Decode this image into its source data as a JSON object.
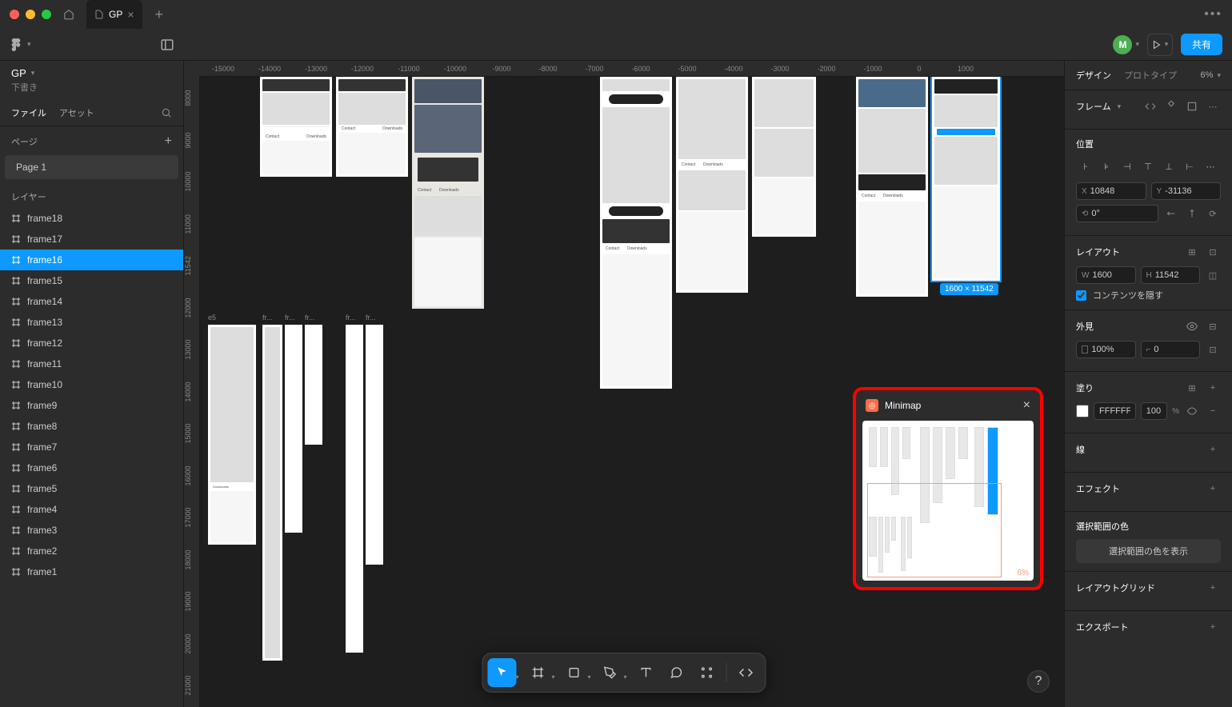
{
  "titlebar": {
    "tab_name": "GP",
    "menu_dots": "•••"
  },
  "left_panel": {
    "file_name": "GP",
    "file_status": "下書き",
    "lib_tabs": {
      "file": "ファイル",
      "assets": "アセット"
    },
    "pages_label": "ページ",
    "pages": [
      "Page 1"
    ],
    "layers_label": "レイヤー",
    "layers": [
      "frame18",
      "frame17",
      "frame16",
      "frame15",
      "frame14",
      "frame13",
      "frame12",
      "frame11",
      "frame10",
      "frame9",
      "frame8",
      "frame7",
      "frame6",
      "frame5",
      "frame4",
      "frame3",
      "frame2",
      "frame1"
    ],
    "selected_layer": "frame16"
  },
  "ruler": {
    "h": [
      "-15000",
      "-14000",
      "-13000",
      "-12000",
      "-11000",
      "-10000",
      "-9000",
      "-8000",
      "-7000",
      "-6000",
      "-5000",
      "-4000",
      "-3000",
      "-2000",
      "-1000",
      "0",
      "1000"
    ],
    "v": [
      "8000",
      "9000",
      "10000",
      "11000",
      "11542",
      "12000",
      "13000",
      "14000",
      "15000",
      "16000",
      "17000",
      "18000",
      "19000",
      "20000",
      "21000"
    ]
  },
  "canvas": {
    "frame_labels": {
      "e5": "e5",
      "f1": "fr...",
      "f2": "fr...",
      "f3": "fr...",
      "f4": "fr...",
      "f5": "fr..."
    },
    "selection_badge": "1600 × 11542"
  },
  "minimap": {
    "title": "Minimap",
    "zoom": "6%"
  },
  "right_panel": {
    "tabs": {
      "design": "デザイン",
      "prototype": "プロトタイプ"
    },
    "zoom": "6%",
    "frame_section": "フレーム",
    "position_section": "位置",
    "x_label": "X",
    "x_value": "10848",
    "y_label": "Y",
    "y_value": "-31136",
    "rotation_value": "0°",
    "autolayout_section": "レイアウト",
    "w_label": "W",
    "w_value": "1600",
    "h_label": "H",
    "h_value": "11542",
    "clip_content": "コンテンツを隠す",
    "appearance_section": "外見",
    "opacity": "100%",
    "corner_value": "0",
    "fill_section": "塗り",
    "fill_hex": "FFFFFF",
    "fill_opacity": "100",
    "fill_pct": "%",
    "stroke_section": "線",
    "effects_section": "エフェクト",
    "selection_colors": "選択範囲の色",
    "show_colors_btn": "選択範囲の色を表示",
    "layout_grid": "レイアウトグリッド",
    "export_section": "エクスポート"
  },
  "toolbar": {
    "avatar_letter": "M",
    "share": "共有"
  },
  "help": "?"
}
